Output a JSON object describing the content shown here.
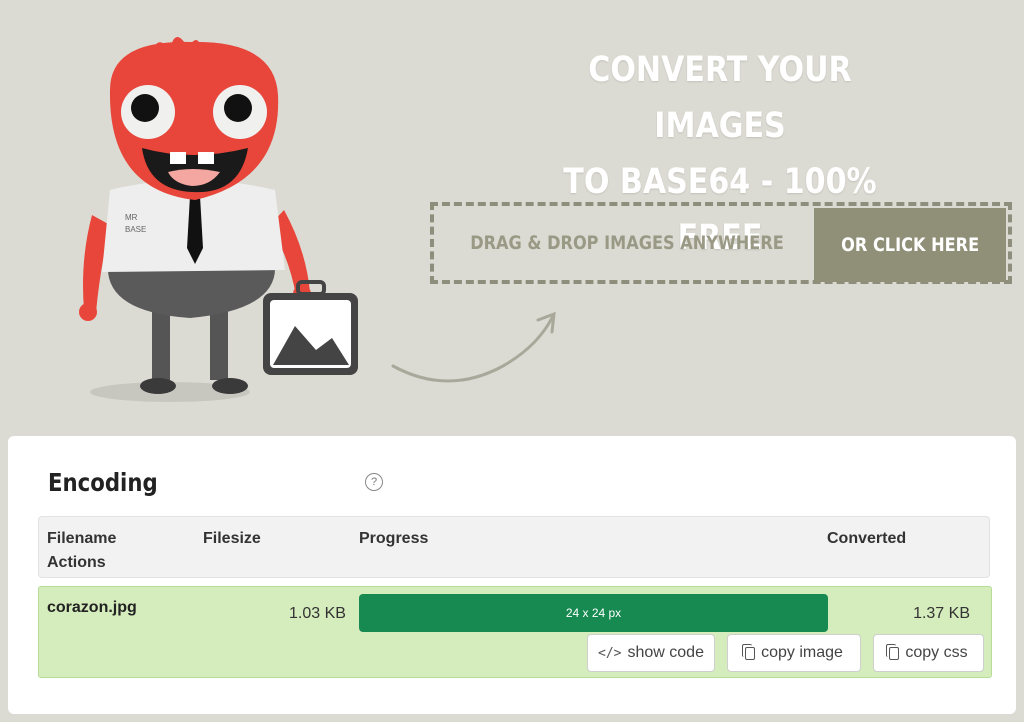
{
  "hero": {
    "headline_line1": "CONVERT YOUR IMAGES",
    "headline_line2": "TO BASE64 - 100% FREE",
    "mascot_shirt_text_line1": "MR",
    "mascot_shirt_text_line2": "BASE",
    "dropzone_text": "DRAG & DROP IMAGES ANYWHERE",
    "click_button_label": "OR CLICK HERE"
  },
  "panel": {
    "title": "Encoding",
    "help_glyph": "?",
    "columns": {
      "filename": "Filename",
      "actions": "Actions",
      "filesize": "Filesize",
      "progress": "Progress",
      "converted": "Converted"
    },
    "rows": [
      {
        "filename": "corazon.jpg",
        "filesize": "1.03 KB",
        "progress_label": "24 x 24 px",
        "progress_percent": 100,
        "converted": "1.37 KB",
        "actions": {
          "show_code": "show code",
          "copy_image": "copy image",
          "copy_css": "copy css"
        }
      }
    ]
  },
  "colors": {
    "background": "#dcdbd3",
    "accent_button": "#909079",
    "progress_fill": "#178a51",
    "row_success": "#d5ecbc"
  }
}
